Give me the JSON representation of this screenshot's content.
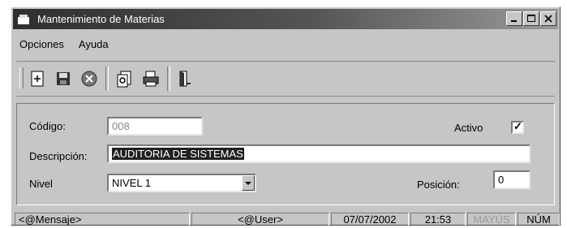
{
  "window": {
    "title": "Mantenimiento de Materias"
  },
  "menu": {
    "items": [
      "Opciones",
      "Ayuda"
    ]
  },
  "toolbar": {
    "buttons": [
      "new-icon",
      "save-icon",
      "cancel-icon",
      "search-icon",
      "print-icon",
      "exit-door-icon"
    ]
  },
  "form": {
    "codigo_label": "Código:",
    "codigo_value": "008",
    "activo_label": "Activo",
    "activo_mark": "✓",
    "descripcion_label": "Descripción:",
    "descripcion_value": "AUDITORIA DE SISTEMAS",
    "nivel_label": "Nivel",
    "nivel_value": "NIVEL 1",
    "posicion_label": "Posición:",
    "posicion_value": "0"
  },
  "status": {
    "mensaje": "<@Mensaje>",
    "user": "<@User>",
    "date": "07/07/2002",
    "time": "21:53",
    "caps": "MAYÚS",
    "num": "NÚM"
  }
}
